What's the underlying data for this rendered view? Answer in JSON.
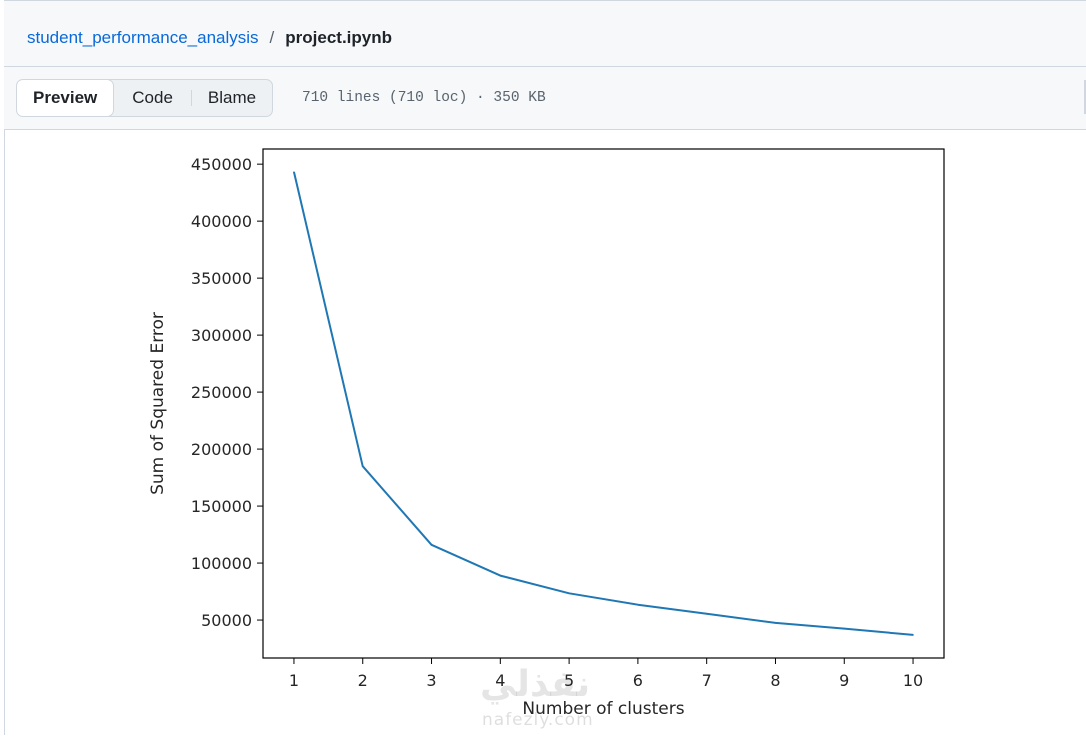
{
  "breadcrumb": {
    "repo": "student_performance_analysis",
    "separator": "/",
    "file": "project.ipynb"
  },
  "toolbar": {
    "tabs": [
      {
        "label": "Preview",
        "active": true
      },
      {
        "label": "Code",
        "active": false
      },
      {
        "label": "Blame",
        "active": false
      }
    ],
    "file_meta": "710 lines (710 loc) · 350 KB"
  },
  "watermark": {
    "arabic": "نفذلي",
    "latin": "nafezly.com"
  },
  "chart_data": {
    "type": "line",
    "title": "",
    "xlabel": "Number of clusters",
    "ylabel": "Sum of Squared Error",
    "x": [
      1,
      2,
      3,
      4,
      5,
      6,
      7,
      8,
      9,
      10
    ],
    "series": [
      {
        "values": [
          443000,
          185000,
          116000,
          89000,
          73500,
          63500,
          55500,
          47500,
          42500,
          37000
        ]
      }
    ],
    "xticks": [
      1,
      2,
      3,
      4,
      5,
      6,
      7,
      8,
      9,
      10
    ],
    "yticks": [
      50000,
      100000,
      150000,
      200000,
      250000,
      300000,
      350000,
      400000,
      450000
    ],
    "xlim": [
      0.55,
      10.45
    ],
    "ylim": [
      16700,
      463300
    ],
    "grid": false,
    "line_color": "#1f77b4"
  }
}
